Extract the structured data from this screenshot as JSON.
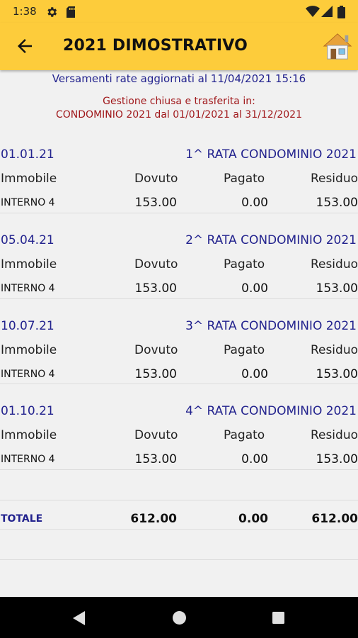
{
  "status": {
    "time": "1:38"
  },
  "header": {
    "title": "2021 DIMOSTRATIVO"
  },
  "info": {
    "updated": "Versamenti rate aggiornati al 11/04/2021 15:16",
    "closed_line1": "Gestione chiusa e trasferita in:",
    "closed_line2": "CONDOMINIO 2021 dal 01/01/2021 al 31/12/2021"
  },
  "columns": {
    "immobile": "Immobile",
    "dovuto": "Dovuto",
    "pagato": "Pagato",
    "residuo": "Residuo"
  },
  "rate": [
    {
      "date": "01.01.21",
      "label": "1^ RATA CONDOMINIO 2021",
      "immobile": "INTERNO 4",
      "dovuto": "153.00",
      "pagato": "0.00",
      "residuo": "153.00"
    },
    {
      "date": "05.04.21",
      "label": "2^ RATA CONDOMINIO 2021",
      "immobile": "INTERNO 4",
      "dovuto": "153.00",
      "pagato": "0.00",
      "residuo": "153.00"
    },
    {
      "date": "10.07.21",
      "label": "3^ RATA CONDOMINIO 2021",
      "immobile": "INTERNO 4",
      "dovuto": "153.00",
      "pagato": "0.00",
      "residuo": "153.00"
    },
    {
      "date": "01.10.21",
      "label": "4^ RATA CONDOMINIO 2021",
      "immobile": "INTERNO 4",
      "dovuto": "153.00",
      "pagato": "0.00",
      "residuo": "153.00"
    }
  ],
  "totale": {
    "label": "TOTALE",
    "dovuto": "612.00",
    "pagato": "0.00",
    "residuo": "612.00"
  },
  "icons": {
    "back": "arrow-back-icon",
    "home": "home-icon",
    "nav_back": "triangle-back-icon",
    "nav_home": "circle-home-icon",
    "nav_recent": "square-recent-icon"
  }
}
